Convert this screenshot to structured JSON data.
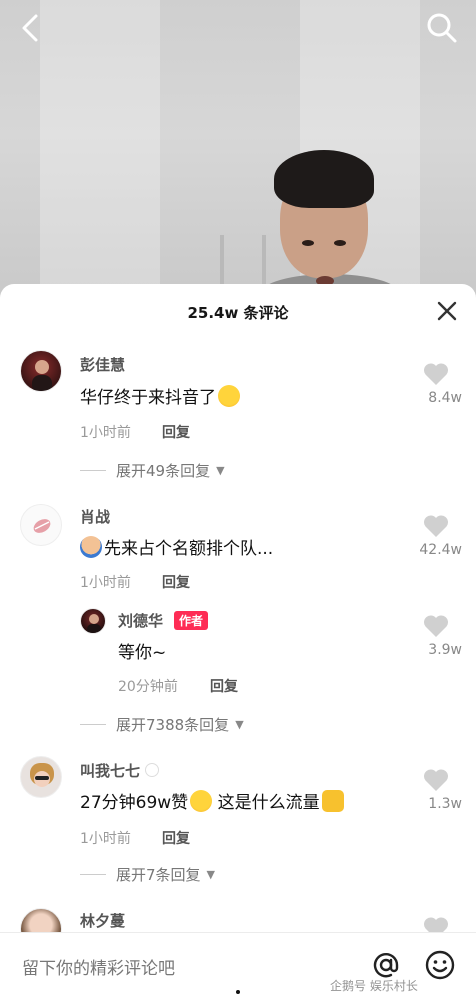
{
  "header": {
    "back_icon": "chevron-left-icon",
    "search_icon": "search-icon"
  },
  "sheet": {
    "title": "25.4w 条评论",
    "close_icon": "close-icon"
  },
  "comments": [
    {
      "username": "彭佳慧",
      "text": "华仔终于来抖音了",
      "emoji": "wink-emoji",
      "time": "1小时前",
      "reply_label": "回复",
      "likes": "8.4w",
      "expand_label": "展开49条回复"
    },
    {
      "username": "肖战",
      "emoji_prefix": "raising-hand-emoji",
      "text": "先来占个名额排个队...",
      "time": "1小时前",
      "reply_label": "回复",
      "likes": "42.4w",
      "reply": {
        "username": "刘德华",
        "badge": "作者",
        "text": "等你~",
        "time": "20分钟前",
        "reply_label": "回复",
        "likes": "3.9w"
      },
      "expand_label": "展开7388条回复"
    },
    {
      "username": "叫我七七",
      "text_part1": "27分钟69w赞",
      "emoji_mid": "pleading-emoji",
      "text_part2": " 这是什么流量",
      "emoji": "thumbs-up-emoji",
      "time": "1小时前",
      "reply_label": "回复",
      "likes": "1.3w",
      "expand_label": "展开7条回复"
    },
    {
      "username": "林夕蔓"
    }
  ],
  "input": {
    "placeholder": "留下你的精彩评论吧",
    "at_icon": "at-icon",
    "emoji_icon": "smiley-icon"
  },
  "watermark": "企鹅号 娱乐村长",
  "colors": {
    "accent": "#fe2c55",
    "muted": "#9a9a9a"
  }
}
